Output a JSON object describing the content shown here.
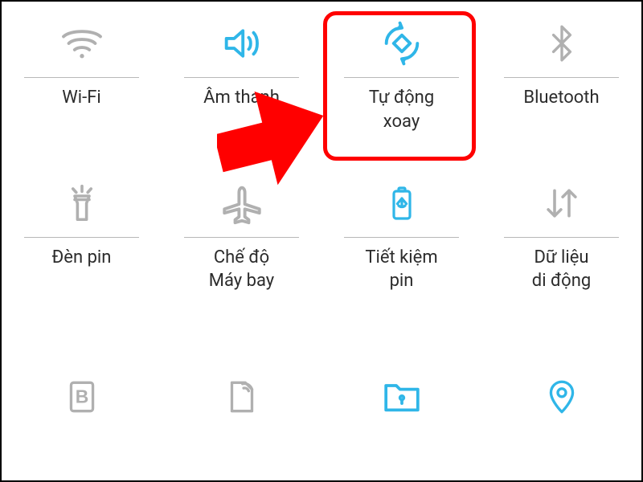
{
  "colors": {
    "active": "#2fb6e8",
    "inactive": "#b0b0b0",
    "text": "#2c2c2c",
    "highlight": "#ff0000"
  },
  "tiles": [
    {
      "key": "wifi",
      "label": "Wi-Fi",
      "state": "inactive",
      "icon": "wifi"
    },
    {
      "key": "sound",
      "label": "Âm thanh",
      "state": "active",
      "icon": "sound"
    },
    {
      "key": "autorotate",
      "label": "Tự động\nxoay",
      "state": "active",
      "icon": "autorotate",
      "highlighted": true
    },
    {
      "key": "bluetooth",
      "label": "Bluetooth",
      "state": "inactive",
      "icon": "bluetooth"
    },
    {
      "key": "flashlight",
      "label": "Đèn pin",
      "state": "inactive",
      "icon": "flashlight"
    },
    {
      "key": "airplane",
      "label": "Chế độ\nMáy bay",
      "state": "inactive",
      "icon": "airplane"
    },
    {
      "key": "battery",
      "label": "Tiết kiệm\npin",
      "state": "active",
      "icon": "battery"
    },
    {
      "key": "mobiledata",
      "label": "Dữ liệu\ndi động",
      "state": "inactive",
      "icon": "mobiledata"
    },
    {
      "key": "bluelight",
      "label": "",
      "state": "inactive",
      "icon": "bluelight"
    },
    {
      "key": "hotspot",
      "label": "",
      "state": "inactive",
      "icon": "hotspot"
    },
    {
      "key": "secure",
      "label": "",
      "state": "active",
      "icon": "secure"
    },
    {
      "key": "location",
      "label": "",
      "state": "active",
      "icon": "location"
    }
  ],
  "highlight": {
    "tileIndex": 2
  },
  "arrow": {
    "pointsToTile": 2
  }
}
